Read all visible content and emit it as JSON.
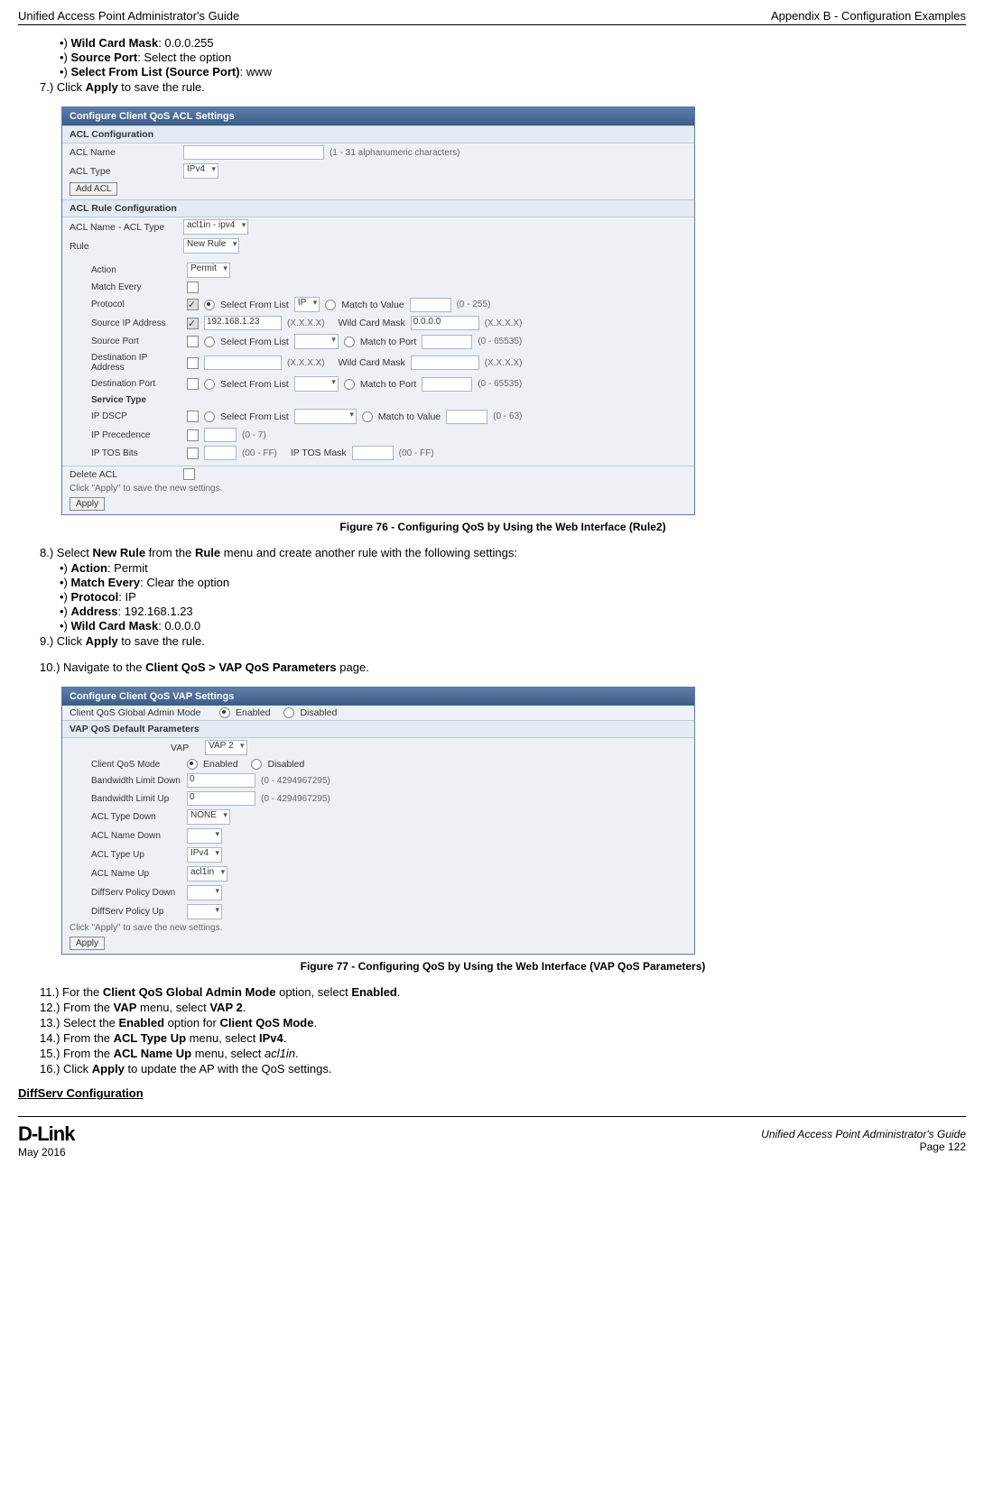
{
  "header": {
    "left": "Unified Access Point Administrator's Guide",
    "right": "Appendix B - Configuration Examples"
  },
  "topBullets": {
    "b1_label": "Wild Card Mask",
    "b1_val": ": 0.0.0.255",
    "b2_label": "Source Port",
    "b2_val": ": Select the option",
    "b3_label": "Select From List (Source Port)",
    "b3_val": ": www"
  },
  "step7": {
    "num": "7.)  Click ",
    "apply": "Apply",
    "rest": " to save the rule."
  },
  "fig76": {
    "title": "Configure Client QoS ACL Settings",
    "s1": "ACL Configuration",
    "aclName": "ACL Name",
    "aclHint": "(1 - 31 alphanumeric characters)",
    "aclType": "ACL Type",
    "aclTypeVal": "IPv4",
    "addBtn": "Add ACL",
    "s2": "ACL Rule Configuration",
    "aclNameType": "ACL Name - ACL Type",
    "aclNameTypeVal": "acl1in - ipv4",
    "rule": "Rule",
    "ruleVal": "New Rule",
    "action": "Action",
    "actionVal": "Permit",
    "matchEvery": "Match Every",
    "protocol": "Protocol",
    "selFrom": "Select From List",
    "ip": "IP",
    "matchVal": "Match to Value",
    "r255": "(0 - 255)",
    "srcIp": "Source IP Address",
    "srcIpVal": "192.168.1.23",
    "xxxx": "(X.X.X.X)",
    "wcm": "Wild Card Mask",
    "wcmVal": "0.0.0.0",
    "srcPort": "Source Port",
    "mtp": "Match to Port",
    "r655": "(0 - 65535)",
    "dstIp": "Destination IP Address",
    "dstPort": "Destination Port",
    "svc": "Service Type",
    "dscp": "IP DSCP",
    "r63": "(0 - 63)",
    "prec": "IP Precedence",
    "r07": "(0 - 7)",
    "tos": "IP TOS Bits",
    "rff": "(00 - FF)",
    "tosMask": "IP TOS Mask",
    "delAcl": "Delete ACL",
    "applyHint": "Click \"Apply\" to save the new settings.",
    "applyBtn": "Apply",
    "caption": "Figure 76 - Configuring QoS by Using the Web Interface (Rule2)"
  },
  "step8": {
    "pre": "8.)  Select ",
    "nr": "New Rule",
    "mid": " from the ",
    "rule": "Rule",
    "post": " menu and create another rule with the following settings:",
    "b1_label": "Action",
    "b1_val": ": Permit",
    "b2_label": "Match Every",
    "b2_val": ": Clear the option",
    "b3_label": "Protocol",
    "b3_val": ": IP",
    "b4_label": "Address",
    "b4_val": ": 192.168.1.23",
    "b5_label": "Wild Card Mask",
    "b5_val": ": 0.0.0.0"
  },
  "step9": {
    "num": "9.)  Click ",
    "apply": "Apply",
    "rest": " to save the rule."
  },
  "step10": {
    "pre": "10.)  Navigate to the ",
    "path": "Client QoS > VAP QoS Parameters",
    "post": " page."
  },
  "fig77": {
    "title": "Configure Client QoS VAP Settings",
    "gMode": "Client QoS Global Admin Mode",
    "en": "Enabled",
    "dis": "Disabled",
    "s1": "VAP QoS Default Parameters",
    "vap": "VAP",
    "vapSel": "VAP 2",
    "qosMode": "Client QoS Mode",
    "bwDown": "Bandwidth Limit Down",
    "bwUp": "Bandwidth Limit Up",
    "zero": "0",
    "range": "(0 - 4294967295)",
    "atDown": "ACL Type Down",
    "none": "NONE",
    "anDown": "ACL Name Down",
    "atUp": "ACL Type Up",
    "ipv4": "IPv4",
    "anUp": "ACL Name Up",
    "acl1in": "acl1in",
    "dspDown": "DiffServ Policy Down",
    "dspUp": "DiffServ Policy Up",
    "applyHint": "Click \"Apply\" to save the new settings.",
    "applyBtn": "Apply",
    "caption": "Figure 77 - Configuring QoS by Using the Web Interface (VAP QoS Parameters)"
  },
  "steps11_16": {
    "s11a": "11.)  For the ",
    "s11b": "Client QoS Global Admin Mode",
    "s11c": " option, select ",
    "s11d": "Enabled",
    "s11e": ".",
    "s12a": "12.)  From the ",
    "s12b": "VAP",
    "s12c": " menu, select ",
    "s12d": "VAP 2",
    "s12e": ".",
    "s13a": "13.)  Select the ",
    "s13b": "Enabled",
    "s13c": " option for ",
    "s13d": "Client QoS Mode",
    "s13e": ".",
    "s14a": "14.)  From the ",
    "s14b": "ACL Type Up",
    "s14c": " menu, select ",
    "s14d": "IPv4",
    "s14e": ".",
    "s15a": "15.)  From the ",
    "s15b": "ACL Name Up",
    "s15c": " menu, select ",
    "s15d": "acl1in",
    "s15e": ".",
    "s16a": "16.)  Click ",
    "s16b": "Apply",
    "s16c": " to update the AP with the QoS settings."
  },
  "diffServ": "DiffServ Configuration",
  "footer": {
    "brand": "D-Link",
    "date": "May 2016",
    "guide": "Unified Access Point Administrator's Guide",
    "page": "Page 122"
  }
}
